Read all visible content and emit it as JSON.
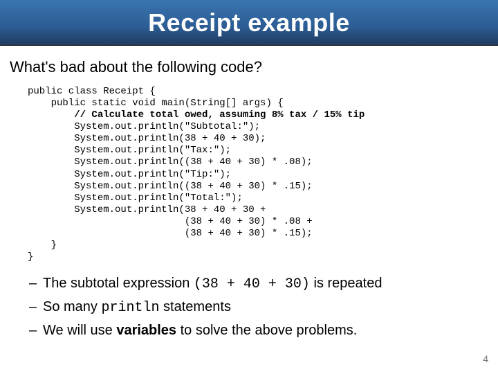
{
  "title": "Receipt example",
  "question": "What's bad about the following code?",
  "code": {
    "l01": "public class Receipt {",
    "l02": "    public static void main(String[] args) {",
    "l03": "        // Calculate total owed, assuming 8% tax / 15% tip",
    "l04": "        System.out.println(\"Subtotal:\");",
    "l05": "        System.out.println(38 + 40 + 30);",
    "l06": "        System.out.println(\"Tax:\");",
    "l07": "        System.out.println((38 + 40 + 30) * .08);",
    "l08": "        System.out.println(\"Tip:\");",
    "l09": "        System.out.println((38 + 40 + 30) * .15);",
    "l10": "        System.out.println(\"Total:\");",
    "l11": "        System.out.println(38 + 40 + 30 +",
    "l12": "                           (38 + 40 + 30) * .08 +",
    "l13": "                           (38 + 40 + 30) * .15);",
    "l14": "    }",
    "l15": "}"
  },
  "bullets": {
    "b1_pre": "The subtotal expression ",
    "b1_code": "(38 + 40 + 30)",
    "b1_post": " is repeated",
    "b2_pre": "So many ",
    "b2_code": "println",
    "b2_post": " statements",
    "b3_pre": "We will use ",
    "b3_bold": "variables",
    "b3_post": " to solve the above problems."
  },
  "dash": "–",
  "page_number": "4"
}
